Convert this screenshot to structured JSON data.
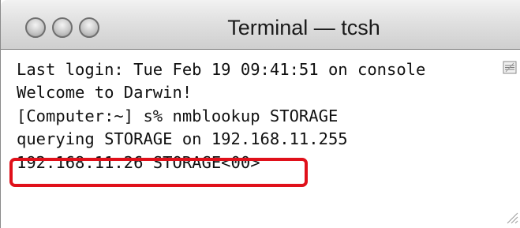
{
  "window": {
    "title": "Terminal — tcsh"
  },
  "terminal": {
    "lines": [
      "Last login: Tue Feb 19 09:41:51 on console",
      "Welcome to Darwin!",
      "[Computer:~] s% nmblookup STORAGE",
      "querying STORAGE on 192.168.11.255",
      "192.168.11.26 STORAGE<00>"
    ]
  },
  "annotation": {
    "highlight_color": "#e0101a"
  },
  "icons": {
    "close": "close-button-circle",
    "minimize": "minimize-button-circle",
    "zoom": "zoom-button-circle",
    "split": "split-pane-icon",
    "resize": "resize-grip-icon"
  }
}
